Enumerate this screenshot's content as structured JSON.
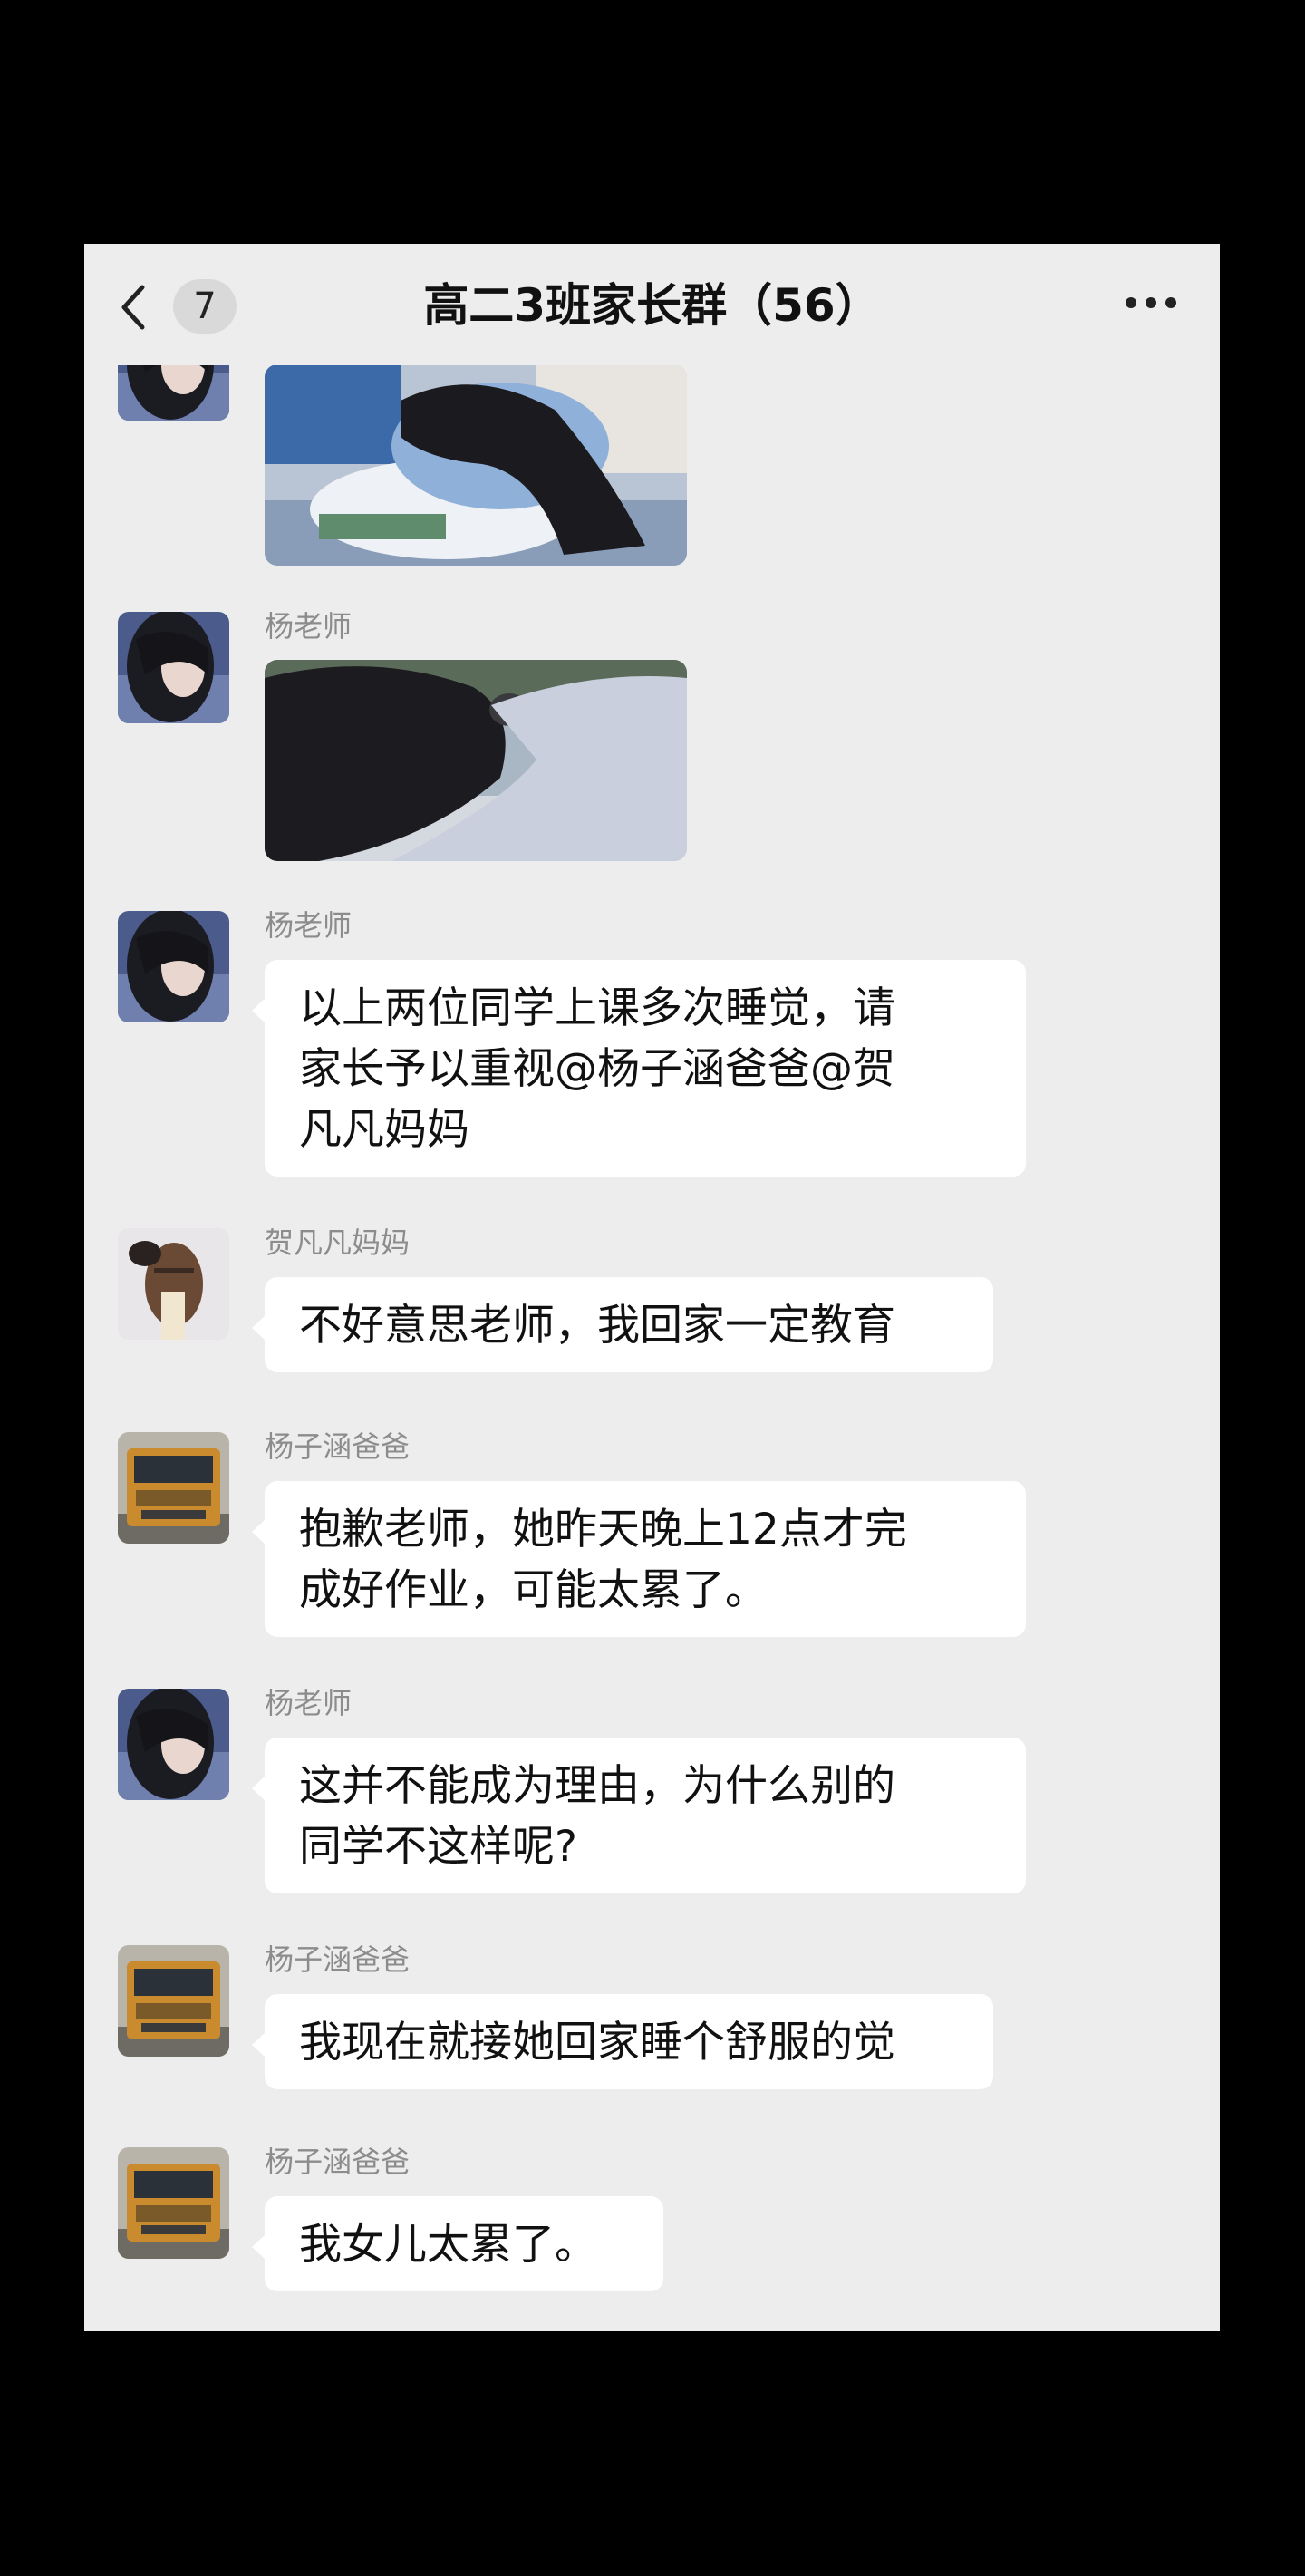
{
  "header": {
    "title": "高二3班家长群（56）",
    "unread_count": "7"
  },
  "messages": [
    {
      "sender": "",
      "type": "image",
      "image": "photo-student-sleeping-on-desk"
    },
    {
      "sender": "杨老师",
      "type": "image",
      "image": "photo-student-head-down-ponytail"
    },
    {
      "sender": "杨老师",
      "type": "text",
      "text_lines": [
        "以上两位同学上课多次睡觉，请",
        "家长予以重视@杨子涵爸爸@贺",
        "凡凡妈妈"
      ]
    },
    {
      "sender": "贺凡凡妈妈",
      "type": "text",
      "text_lines": [
        "不好意思老师，我回家一定教育"
      ]
    },
    {
      "sender": "杨子涵爸爸",
      "type": "text",
      "text_lines": [
        "抱歉老师，她昨天晚上12点才完",
        "成好作业，可能太累了。"
      ]
    },
    {
      "sender": "杨老师",
      "type": "text",
      "text_lines": [
        "这并不能成为理由，为什么别的",
        "同学不这样呢?"
      ]
    },
    {
      "sender": "杨子涵爸爸",
      "type": "text",
      "text_lines": [
        "我现在就接她回家睡个舒服的觉"
      ]
    },
    {
      "sender": "杨子涵爸爸",
      "type": "text",
      "text_lines": [
        "我女儿太累了。"
      ]
    }
  ],
  "icons": {
    "back": "chevron-left-icon",
    "more": "more-dots-icon"
  },
  "colors": {
    "background": "#ededed",
    "bubble": "#ffffff",
    "sender_name": "#8c8c8c",
    "outer_frame": "#000000"
  }
}
